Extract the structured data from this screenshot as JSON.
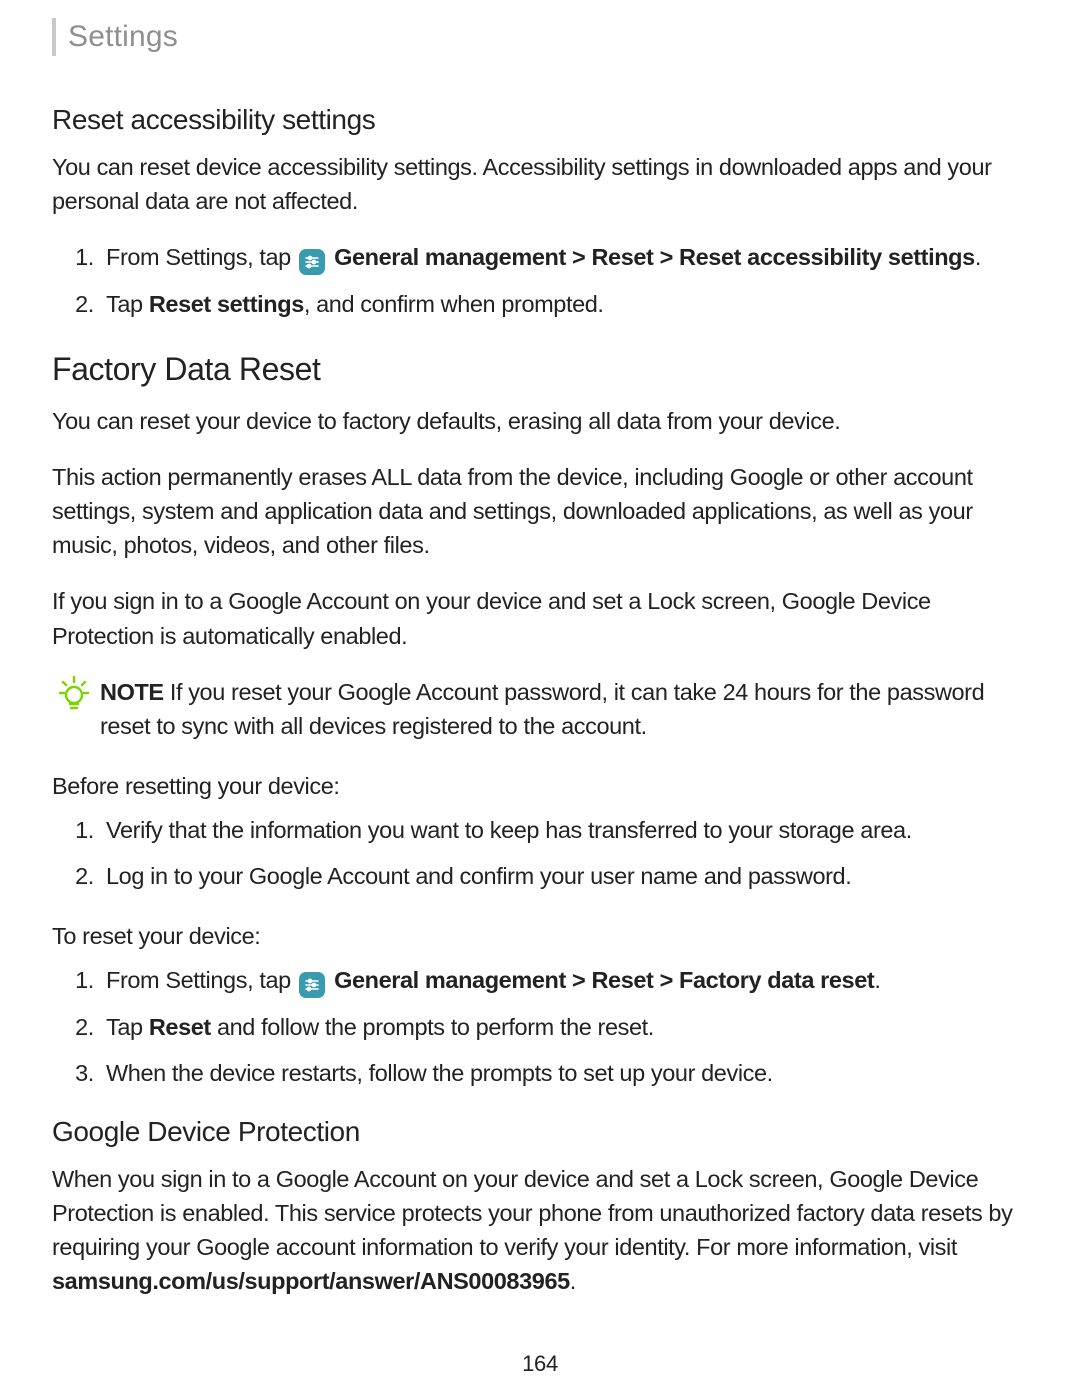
{
  "crumb": "Settings",
  "ras": {
    "title": "Reset accessibility settings",
    "intro": "You can reset device accessibility settings. Accessibility settings in downloaded apps and your personal data are not affected.",
    "step1_pre": "From Settings, tap ",
    "step1_bold": "General management > Reset > Reset accessibility settings",
    "step1_post": ".",
    "step2_pre": "Tap ",
    "step2_bold": "Reset settings",
    "step2_post": ", and confirm when prompted."
  },
  "fdr": {
    "title": "Factory Data Reset",
    "p1": "You can reset your device to factory defaults, erasing all data from your device.",
    "p2": "This action permanently erases ALL data from the device, including Google or other account settings, system and application data and settings, downloaded applications, as well as your music, photos, videos, and other files.",
    "p3": "If you sign in to a Google Account on your device and set a Lock screen, Google Device Protection is automatically enabled.",
    "note_label": "NOTE",
    "note_text": " If you reset your Google Account password, it can take 24 hours for the password reset to sync with all devices registered to the account.",
    "before": "Before resetting your device:",
    "b1": "Verify that the information you want to keep has transferred to your storage area.",
    "b2": "Log in to your Google Account and confirm your user name and password.",
    "to_reset": "To reset your device:",
    "r1_pre": "From Settings, tap ",
    "r1_bold": "General management > Reset > Factory data reset",
    "r1_post": ".",
    "r2_pre": "Tap ",
    "r2_bold": "Reset",
    "r2_post": " and follow the prompts to perform the reset.",
    "r3": "When the device restarts, follow the prompts to set up your device."
  },
  "gdp": {
    "title": "Google Device Protection",
    "text_pre": "When you sign in to a Google Account on your device and set a Lock screen, Google Device Protection is enabled. This service protects your phone from unauthorized factory data resets by requiring your Google account information to verify your identity. For more information, visit ",
    "link": "samsung.com/us/support/answer/ANS00083965",
    "text_post": "."
  },
  "page_number": "164"
}
